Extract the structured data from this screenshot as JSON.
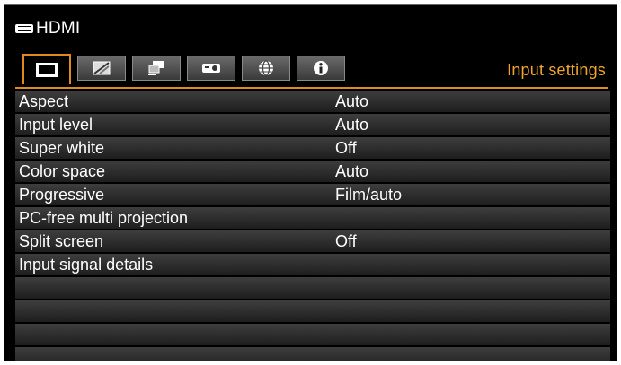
{
  "source": {
    "badge_icon": "hdmi-icon",
    "label": "HDMI"
  },
  "tabs": [
    {
      "icon": "image-adjust-icon",
      "active": true
    },
    {
      "icon": "image-quality-icon",
      "active": false
    },
    {
      "icon": "display-settings-icon",
      "active": false
    },
    {
      "icon": "projector-settings-icon",
      "active": false
    },
    {
      "icon": "network-globe-icon",
      "active": false
    },
    {
      "icon": "info-icon",
      "active": false
    }
  ],
  "tab_title": "Input settings",
  "accent_color": "#e08a1e",
  "title_color": "#f0a52a",
  "menu": [
    {
      "label": "Aspect",
      "value": "Auto"
    },
    {
      "label": "Input level",
      "value": "Auto"
    },
    {
      "label": "Super white",
      "value": "Off"
    },
    {
      "label": "Color space",
      "value": "Auto"
    },
    {
      "label": "Progressive",
      "value": "Film/auto"
    },
    {
      "label": "PC-free multi projection",
      "value": ""
    },
    {
      "label": "Split screen",
      "value": "Off"
    },
    {
      "label": "Input signal details",
      "value": ""
    },
    {
      "label": "",
      "value": ""
    },
    {
      "label": "",
      "value": ""
    },
    {
      "label": "",
      "value": ""
    },
    {
      "label": "",
      "value": ""
    }
  ]
}
